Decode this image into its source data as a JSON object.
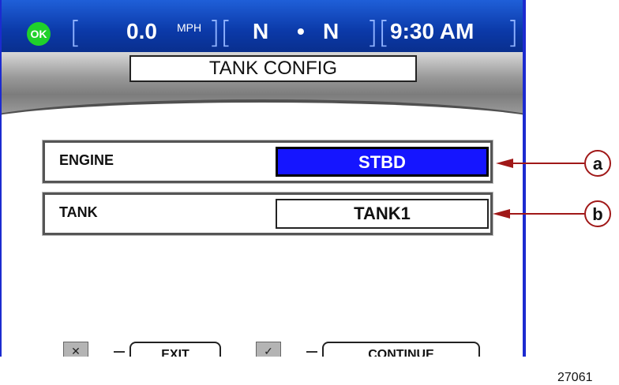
{
  "status_bar": {
    "ok_label": "OK",
    "speed": "0.0",
    "speed_unit": "MPH",
    "gear_port": "N",
    "separator": "•",
    "gear_stbd": "N",
    "time": "9:30 AM",
    "bracket_open": "[",
    "bracket_close": "]",
    "bracket_pair": "][",
    "ok_color": "#1fd12a"
  },
  "screen_title": "TANK CONFIG",
  "settings": [
    {
      "label": "ENGINE",
      "value": "STBD",
      "selected": true
    },
    {
      "label": "TANK",
      "value": "TANK1",
      "selected": false
    }
  ],
  "footer": {
    "exit_icon": "✕",
    "exit_label": "EXIT",
    "continue_icon": "✓",
    "continue_label": "CONTINUE"
  },
  "callouts": [
    "a",
    "b"
  ],
  "figure_number": "27061",
  "colors": {
    "selected_bg": "#1515ff",
    "statusbar": "#0b39a8",
    "callout": "#a01818"
  }
}
